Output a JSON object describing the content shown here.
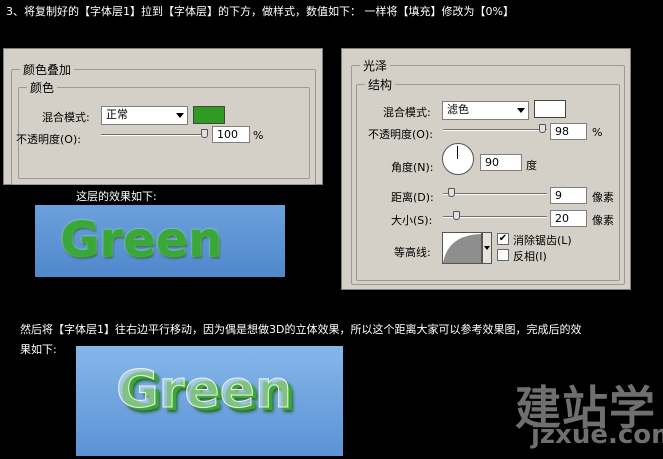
{
  "step_intro": "3、将复制好的【字体层1】拉到【字体层】的下方，做样式，数值如下：  一样将【填充】修改为【0%】",
  "color_overlay": {
    "title": "颜色叠加",
    "section": "颜色",
    "blend_label": "混合模式:",
    "blend_value": "正常",
    "color": "#2f9a22",
    "opacity_label": "不透明度(O):",
    "opacity_value": "100",
    "opacity_unit": "%",
    "opacity_level": 1.0
  },
  "layer_effect_caption": "这层的效果如下:",
  "satin": {
    "title": "光泽",
    "section": "结构",
    "blend_label": "混合模式:",
    "blend_value": "滤色",
    "color": "#ffffff",
    "opacity_label": "不透明度(O):",
    "opacity_value": "98",
    "opacity_unit": "%",
    "opacity_level": 0.98,
    "angle_label": "角度(N):",
    "angle_value": "90",
    "angle_unit": "度",
    "distance_label": "距离(D):",
    "distance_value": "9",
    "distance_unit": "像素",
    "size_label": "大小(S):",
    "size_value": "20",
    "size_unit": "像素",
    "contour_label": "等高线:",
    "anti_alias_label": "消除锯齿(L)",
    "anti_alias_checked": "✔",
    "invert_label": "反相(I)"
  },
  "preview_word": "Green",
  "move_instruction_line1": "然后将【字体层1】往右边平行移动，因为偶是想做3D的立体效果，所以这个距离大家可以参考效果图，完成后的效",
  "move_instruction_line2": "果如下:",
  "watermark_cn": "建站学",
  "watermark_url": "jzxue.com",
  "colors": {
    "page_bg": "#000000",
    "panel_bg": "#d4d0c8",
    "preview_blue": "#5b93d6",
    "text_green": "#2e9a2a"
  }
}
